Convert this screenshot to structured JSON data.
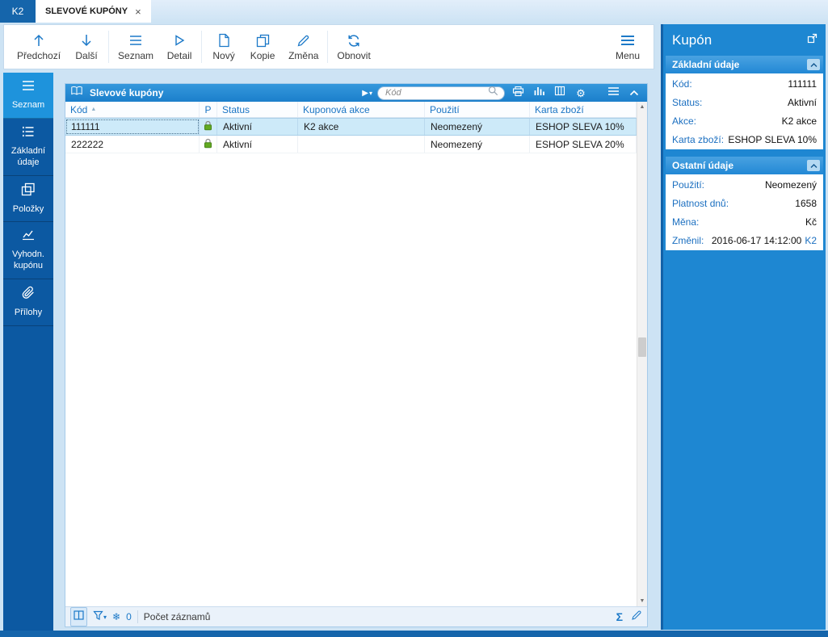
{
  "colors": {
    "accent_blue": "#1e87d2",
    "dark_blue": "#1565ab",
    "sidebar_blue": "#0c59a2",
    "active_item_blue": "#1e93dc",
    "label_blue": "#1b6fc0",
    "toolbar_icon_blue": "#1c79c8",
    "selected_row": "#cdeaf9",
    "lock_green": "#63aa21"
  },
  "glyphs": {
    "close": "×",
    "sort_asc": "▲",
    "gear": "⚙",
    "snowflake": "❄",
    "sigma": "Σ",
    "play": "▶",
    "caret_down": "▾",
    "scroll_up": "▲",
    "scroll_down": "▼"
  },
  "tabs": {
    "app": "K2",
    "active": "SLEVOVÉ KUPÓNY"
  },
  "toolbar": {
    "buttons": [
      {
        "label": "Předchozí",
        "icon": "arrow-up-icon"
      },
      {
        "label": "Další",
        "icon": "arrow-down-icon"
      },
      {
        "label": "Seznam",
        "icon": "list-icon"
      },
      {
        "label": "Detail",
        "icon": "play-outline-icon"
      },
      {
        "label": "Nový",
        "icon": "new-document-icon"
      },
      {
        "label": "Kopie",
        "icon": "copy-icon"
      },
      {
        "label": "Změna",
        "icon": "pencil-icon"
      },
      {
        "label": "Obnovit",
        "icon": "refresh-icon"
      }
    ],
    "menu": {
      "label": "Menu",
      "icon": "menu-icon"
    }
  },
  "sidebar": {
    "items": [
      {
        "label": "Seznam",
        "icon": "list-icon",
        "active": true
      },
      {
        "label": "Základní údaje",
        "icon": "detail-list-icon",
        "active": false
      },
      {
        "label": "Položky",
        "icon": "items-icon",
        "active": false
      },
      {
        "label": "Vyhodn. kupónu",
        "icon": "line-chart-icon",
        "active": false
      },
      {
        "label": "Přílohy",
        "icon": "paperclip-icon",
        "active": false
      }
    ]
  },
  "grid": {
    "title": "Slevové kupóny",
    "search": {
      "placeholder": "Kód"
    },
    "columns": [
      "Kód",
      "P",
      "Status",
      "Kuponová akce",
      "Použití",
      "Karta zboží"
    ],
    "rows": [
      {
        "kod": "111111",
        "status": "Aktivní",
        "kuponova_akce": "K2 akce",
        "pouziti": "Neomezený",
        "karta_zbozi": "ESHOP SLEVA 10%",
        "selected": true
      },
      {
        "kod": "222222",
        "status": "Aktivní",
        "kuponova_akce": "",
        "pouziti": "Neomezený",
        "karta_zbozi": "ESHOP SLEVA 20%",
        "selected": false
      }
    ],
    "statusbar": {
      "frozen_count": "0",
      "records_label": "Počet záznamů"
    }
  },
  "detail": {
    "title": "Kupón",
    "sections": [
      {
        "title": "Základní údaje",
        "fields": [
          {
            "label": "Kód:",
            "value": "111111"
          },
          {
            "label": "Status:",
            "value": "Aktivní"
          },
          {
            "label": "Akce:",
            "value": "K2 akce"
          },
          {
            "label": "Karta zboží:",
            "value": "ESHOP SLEVA 10%"
          }
        ]
      },
      {
        "title": "Ostatní údaje",
        "fields": [
          {
            "label": "Použití:",
            "value": "Neomezený"
          },
          {
            "label": "Platnost dnů:",
            "value": "1658"
          },
          {
            "label": "Měna:",
            "value": "Kč"
          },
          {
            "label": "Změnil:",
            "value": "2016-06-17 14:12:00",
            "value_suffix": "K2"
          }
        ]
      }
    ]
  }
}
